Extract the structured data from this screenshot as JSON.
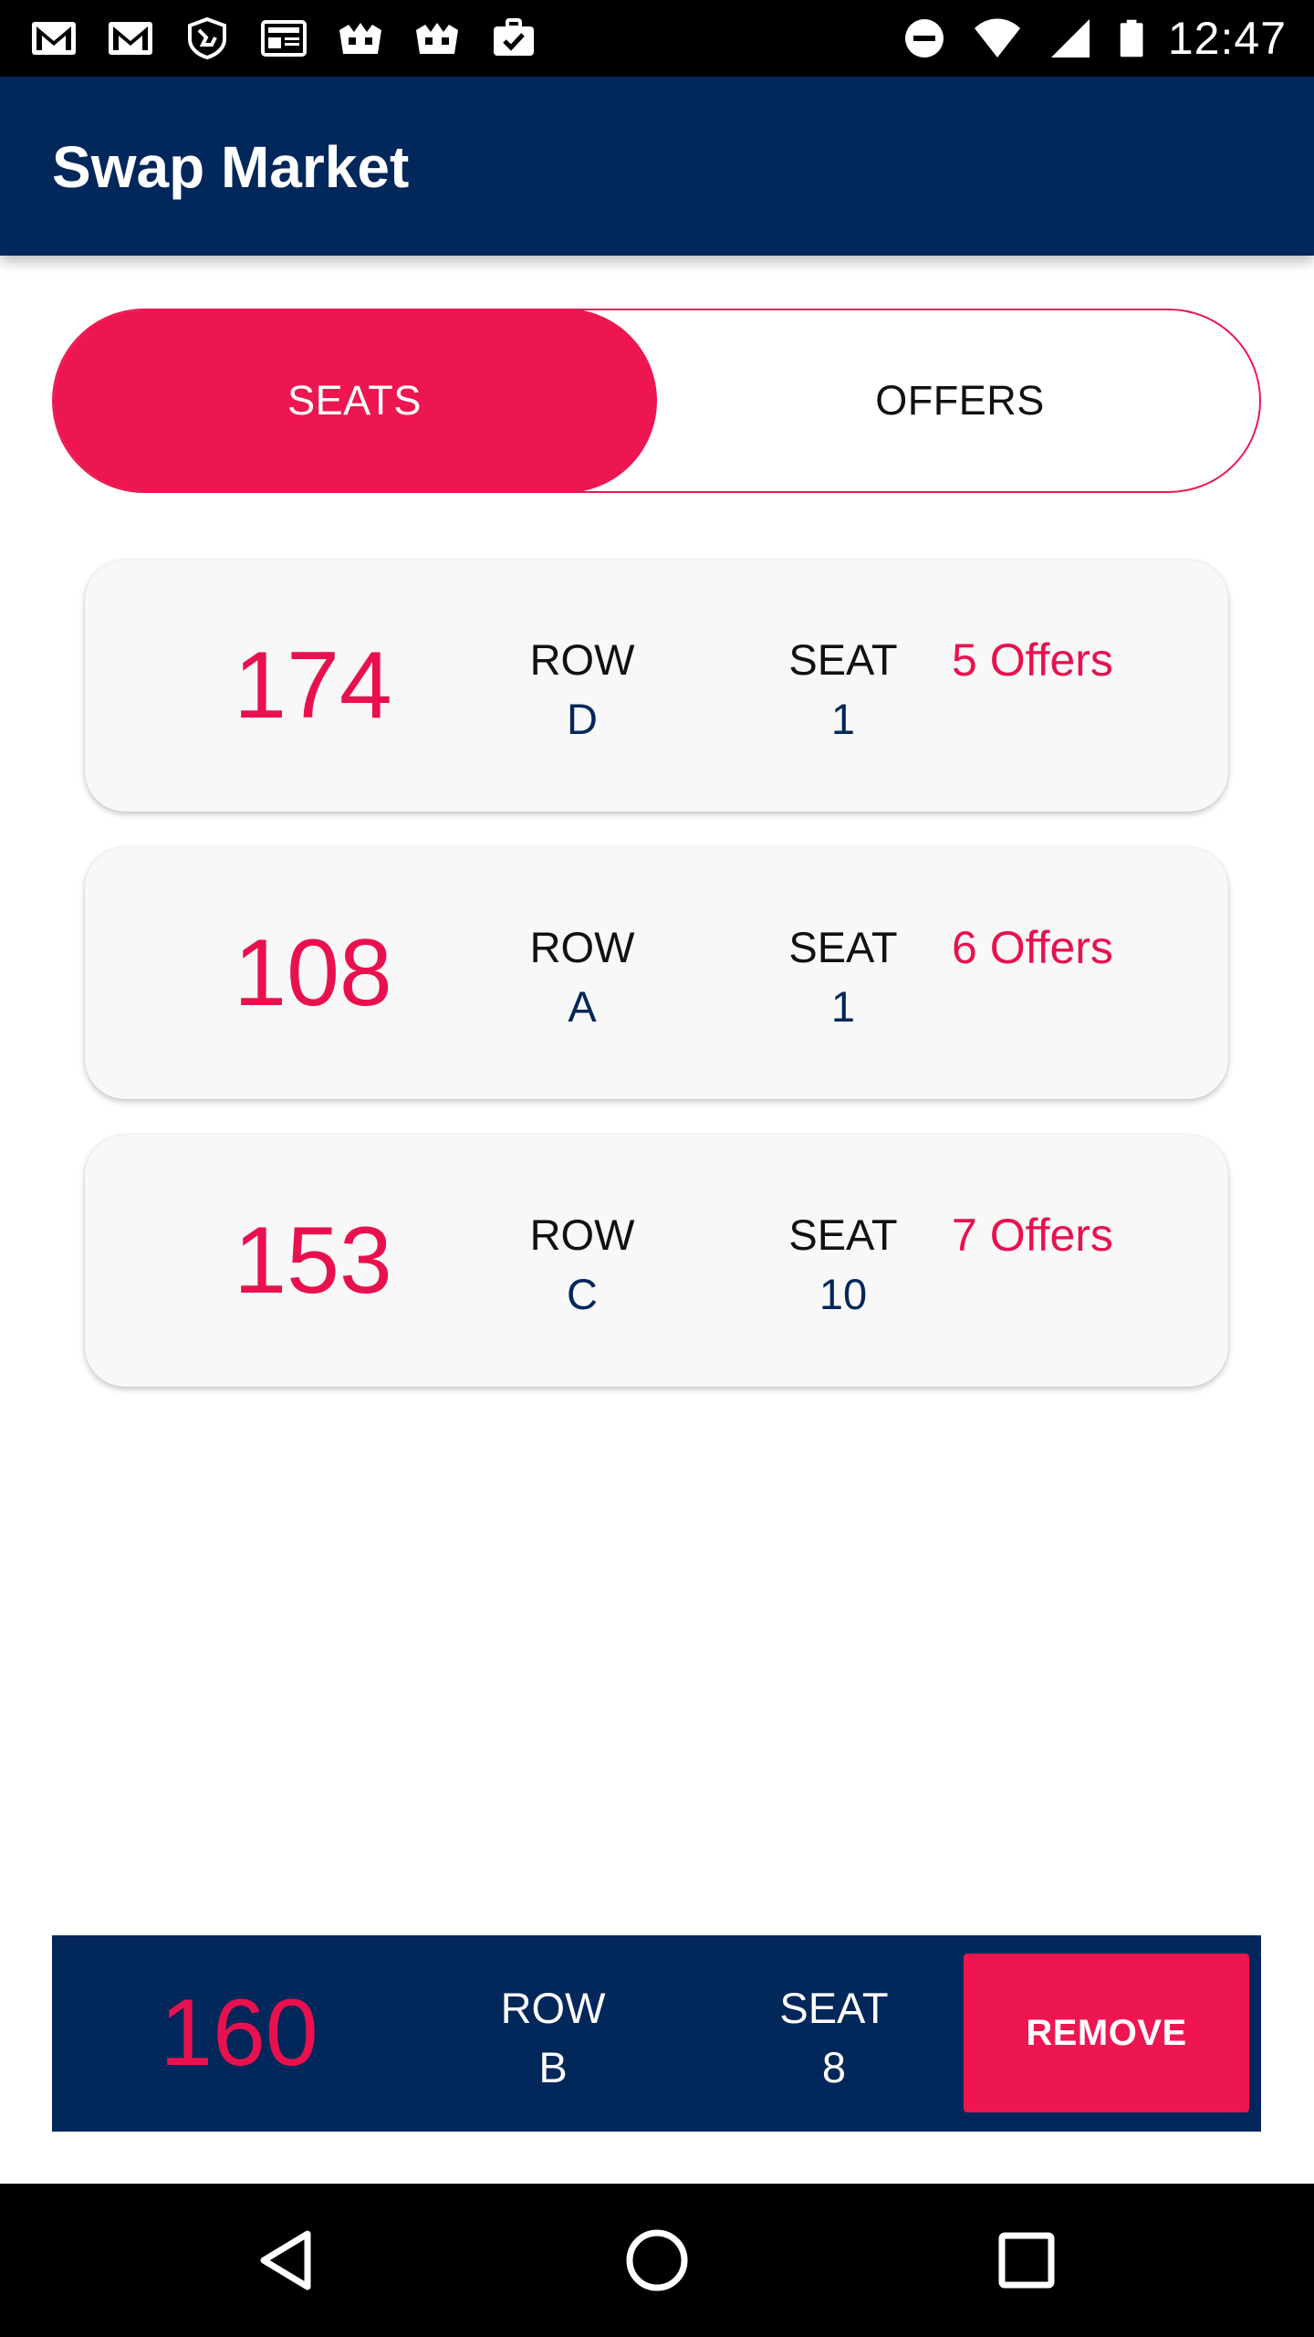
{
  "status_bar": {
    "time": "12:47",
    "left_icons": [
      "gmail-icon",
      "gmail-icon",
      "shield-hand-icon",
      "news-icon",
      "crown-icon",
      "crown-icon",
      "briefcase-check-icon"
    ],
    "right_icons": [
      "do-not-disturb-icon",
      "wifi-icon",
      "signal-icon",
      "battery-icon"
    ]
  },
  "app_bar": {
    "title": "Swap Market"
  },
  "tabs": [
    {
      "label": "SEATS",
      "active": true
    },
    {
      "label": "OFFERS",
      "active": false
    }
  ],
  "seats": [
    {
      "section": "174",
      "row_label": "ROW",
      "row": "D",
      "seat_label": "SEAT",
      "seat": "1",
      "offers": "5 Offers"
    },
    {
      "section": "108",
      "row_label": "ROW",
      "row": "A",
      "seat_label": "SEAT",
      "seat": "1",
      "offers": "6 Offers"
    },
    {
      "section": "153",
      "row_label": "ROW",
      "row": "C",
      "seat_label": "SEAT",
      "seat": "10",
      "offers": "7 Offers"
    }
  ],
  "selected_seat": {
    "section": "160",
    "row_label": "ROW",
    "row": "B",
    "seat_label": "SEAT",
    "seat": "8",
    "remove_label": "REMOVE"
  },
  "colors": {
    "primary_navy": "#02275a",
    "accent_pink": "#ee1650"
  },
  "nav_bar": {
    "icons": [
      "back-icon",
      "home-icon",
      "recents-icon"
    ]
  }
}
